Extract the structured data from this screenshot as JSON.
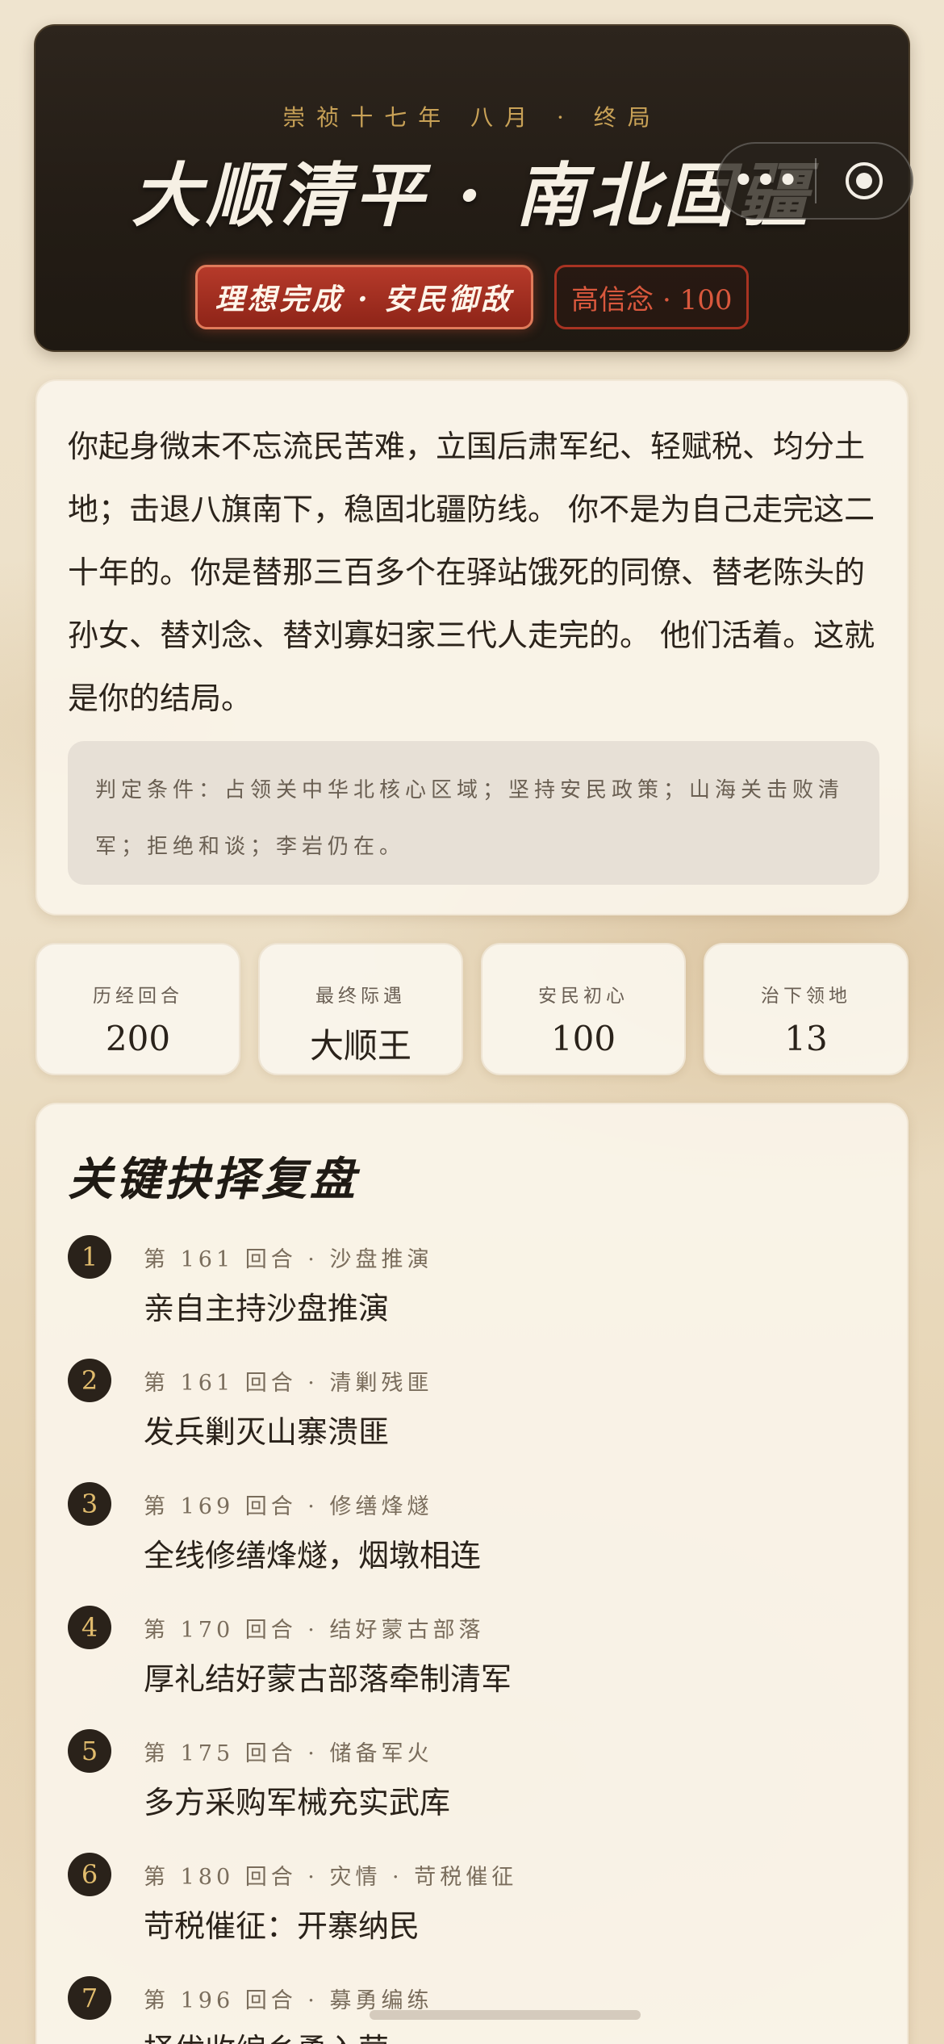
{
  "hero": {
    "subtitle": "崇祯十七年 八月 · 终局",
    "title": "大顺清平 · 南北固疆",
    "badge_main": "理想完成 · 安民御敌",
    "badge_second": "高信念 · 100"
  },
  "capsule": {
    "more": "•••",
    "more_icon": "ellipsis-icon",
    "target_icon": "record-circle-icon"
  },
  "story": {
    "text": "你起身微末不忘流民苦难，立国后肃军纪、轻赋税、均分土地；击退八旗南下，稳固北疆防线。 你不是为自己走完这二十年的。你是替那三百多个在驿站饿死的同僚、替老陈头的孙女、替刘念、替刘寡妇家三代人走完的。 他们活着。这就是你的结局。",
    "criteria": "判定条件：占领关中华北核心区域；坚持安民政策；山海关击败清军；拒绝和谈；李岩仍在。"
  },
  "stats": [
    {
      "label": "历经回合",
      "value": "200"
    },
    {
      "label": "最终际遇",
      "value": "大顺王"
    },
    {
      "label": "安民初心",
      "value": "100"
    },
    {
      "label": "治下领地",
      "value": "13"
    }
  ],
  "choices": {
    "title": "关键抉择复盘",
    "items": [
      {
        "num": "1",
        "meta": "第 161 回合 · 沙盘推演",
        "text": "亲自主持沙盘推演"
      },
      {
        "num": "2",
        "meta": "第 161 回合 · 清剿残匪",
        "text": "发兵剿灭山寨溃匪"
      },
      {
        "num": "3",
        "meta": "第 169 回合 · 修缮烽燧",
        "text": "全线修缮烽燧，烟墩相连"
      },
      {
        "num": "4",
        "meta": "第 170 回合 · 结好蒙古部落",
        "text": "厚礼结好蒙古部落牵制清军"
      },
      {
        "num": "5",
        "meta": "第 175 回合 · 储备军火",
        "text": "多方采购军械充实武库"
      },
      {
        "num": "6",
        "meta": "第 180 回合 · 灾情 · 苛税催征",
        "text": "苛税催征：开寨纳民"
      },
      {
        "num": "7",
        "meta": "第 196 回合 · 募勇编练",
        "text": "择优收编乡勇入营"
      }
    ]
  },
  "colors": {
    "accent_gold": "#c9a257",
    "accent_red": "#b63a2a",
    "dark": "#2a221a"
  }
}
